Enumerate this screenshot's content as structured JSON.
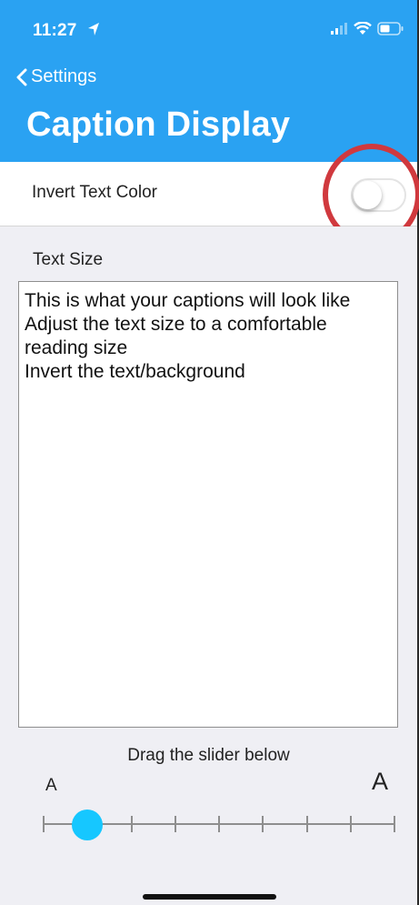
{
  "status_bar": {
    "time": "11:27"
  },
  "nav": {
    "back_label": "Settings",
    "title": "Caption Display"
  },
  "invert_row": {
    "label": "Invert Text Color",
    "toggle_on": false
  },
  "text_size": {
    "label": "Text Size",
    "preview_lines": [
      "This is what your captions will look like",
      "Adjust the text size to a comfortable reading size",
      "Invert the text/background"
    ]
  },
  "slider": {
    "instruction": "Drag the slider below",
    "min_label": "A",
    "max_label": "A",
    "steps": 9,
    "value_step": 1
  },
  "colors": {
    "header_bg": "#2aa2f2",
    "slider_thumb": "#16c7ff",
    "highlight_ring": "#d0393e",
    "section_bg": "#efeff4"
  }
}
